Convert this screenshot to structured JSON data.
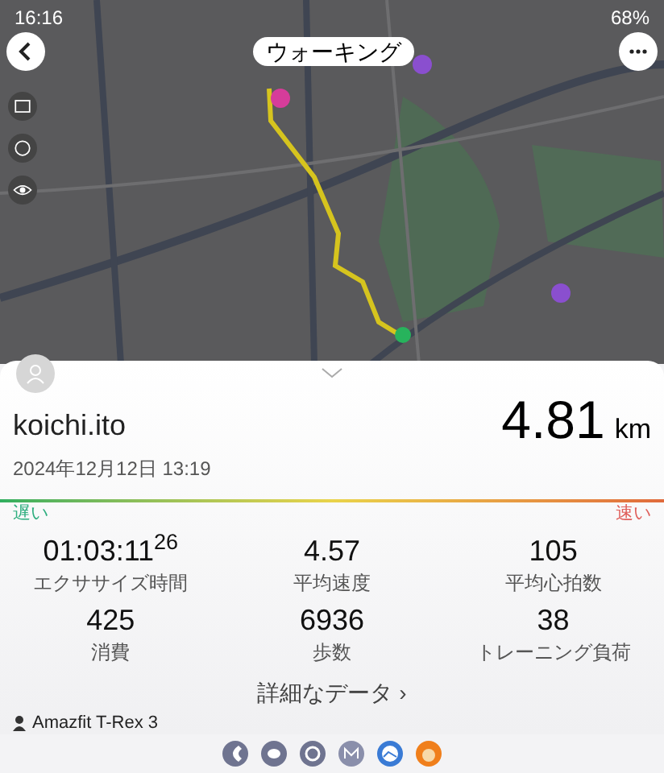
{
  "status_bar": {
    "time": "16:16",
    "battery": "68%"
  },
  "header": {
    "title": "ウォーキング"
  },
  "summary": {
    "user": "koichi.ito",
    "date": "2024年12月12日 13:19",
    "distance": "4.81",
    "unit": "km",
    "slow_label": "遅い",
    "fast_label": "速い"
  },
  "stats": [
    {
      "value": "01:03:11",
      "sup": "26",
      "label": "エクササイズ時間"
    },
    {
      "value": "4.57",
      "label": "平均速度"
    },
    {
      "value": "105",
      "label": "平均心拍数"
    },
    {
      "value": "425",
      "label": "消費"
    },
    {
      "value": "6936",
      "label": "歩数"
    },
    {
      "value": "38",
      "label": "トレーニング負荷"
    }
  ],
  "details_link": "詳細なデータ ›",
  "device": "Amazfit T-Rex 3",
  "taskbar": {
    "apps": [
      {
        "kind": "phone"
      },
      {
        "kind": "chat"
      },
      {
        "kind": "browser"
      },
      {
        "kind": "mail"
      },
      {
        "kind": "gallery"
      },
      {
        "kind": "cat"
      }
    ]
  }
}
